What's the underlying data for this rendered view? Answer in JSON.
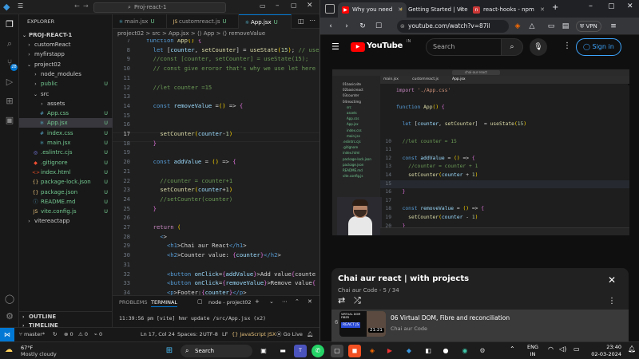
{
  "vscode": {
    "search_text": "Proj-react-1",
    "sidebar": {
      "header": "EXPLORER",
      "root": "PROJ-REACT-1",
      "items": [
        {
          "label": "customReact",
          "indent": 1,
          "kind": "folder",
          "badge": ""
        },
        {
          "label": "myfirstapp",
          "indent": 1,
          "kind": "folder",
          "badge": ""
        },
        {
          "label": "project02",
          "indent": 1,
          "kind": "folder-open",
          "badge": ""
        },
        {
          "label": "node_modules",
          "indent": 2,
          "kind": "folder",
          "badge": ""
        },
        {
          "label": "public",
          "indent": 2,
          "kind": "folder",
          "badge": "U"
        },
        {
          "label": "src",
          "indent": 2,
          "kind": "folder-open",
          "badge": ""
        },
        {
          "label": "assets",
          "indent": 3,
          "kind": "folder",
          "badge": ""
        },
        {
          "label": "App.css",
          "indent": 3,
          "kind": "css",
          "badge": "U"
        },
        {
          "label": "App.jsx",
          "indent": 3,
          "kind": "jsx",
          "badge": "U"
        },
        {
          "label": "index.css",
          "indent": 3,
          "kind": "css",
          "badge": "U"
        },
        {
          "label": "main.jsx",
          "indent": 3,
          "kind": "jsx",
          "badge": "U"
        },
        {
          "label": ".eslintrc.cjs",
          "indent": 2,
          "kind": "eslint",
          "badge": "U"
        },
        {
          "label": ".gitignore",
          "indent": 2,
          "kind": "git",
          "badge": "U"
        },
        {
          "label": "index.html",
          "indent": 2,
          "kind": "html",
          "badge": "U"
        },
        {
          "label": "package-lock.json",
          "indent": 2,
          "kind": "json",
          "badge": "U"
        },
        {
          "label": "package.json",
          "indent": 2,
          "kind": "json",
          "badge": "U"
        },
        {
          "label": "README.md",
          "indent": 2,
          "kind": "md",
          "badge": "U"
        },
        {
          "label": "vite.config.js",
          "indent": 2,
          "kind": "js",
          "badge": "U"
        },
        {
          "label": "vitereactapp",
          "indent": 1,
          "kind": "folder",
          "badge": ""
        }
      ],
      "outline": "OUTLINE",
      "timeline": "TIMELINE"
    },
    "tabs": [
      {
        "label": "main.jsx",
        "badge": "U"
      },
      {
        "label": "customreact.js",
        "badge": "U"
      },
      {
        "label": "App.jsx",
        "badge": "U"
      }
    ],
    "breadcrumb": "project02 > src > App.jsx > ⟨⟩ App > ⟨⟩ removeValue",
    "code": [
      {
        "n": "7",
        "t": "function App() {"
      },
      {
        "n": "8",
        "t": "  let [counter, setCounter] = useState(15); // use"
      },
      {
        "n": "9",
        "t": "  //const [counter, setCounter] = useState(15);"
      },
      {
        "n": "10",
        "t": "  // const give eroror that's why we use let here"
      },
      {
        "n": "11",
        "t": ""
      },
      {
        "n": "12",
        "t": "  //let counter =15"
      },
      {
        "n": "13",
        "t": ""
      },
      {
        "n": "14",
        "t": "  const removeValue =() => {"
      },
      {
        "n": "15",
        "t": ""
      },
      {
        "n": "16",
        "t": ""
      },
      {
        "n": "17",
        "t": "    setCounter(counter-1)"
      },
      {
        "n": "18",
        "t": "  }"
      },
      {
        "n": "19",
        "t": ""
      },
      {
        "n": "20",
        "t": "  const addValue = () => {"
      },
      {
        "n": "21",
        "t": ""
      },
      {
        "n": "22",
        "t": "    //counter = counter+1"
      },
      {
        "n": "23",
        "t": "    setCounter(counter+1)"
      },
      {
        "n": "24",
        "t": "    //setCounter(counter)"
      },
      {
        "n": "25",
        "t": "  }"
      },
      {
        "n": "26",
        "t": ""
      },
      {
        "n": "27",
        "t": "  return ("
      },
      {
        "n": "28",
        "t": "    <>"
      },
      {
        "n": "29",
        "t": "      <h1>Chai aur React</h1>"
      },
      {
        "n": "30",
        "t": "      <h2>Counter value: {counter}</h2>"
      },
      {
        "n": "31",
        "t": ""
      },
      {
        "n": "32",
        "t": "      <button onClick={addValue}>Add value{counte"
      },
      {
        "n": "33",
        "t": "      <button onClick={removeValue}>Remove value{"
      },
      {
        "n": "34",
        "t": "      <p>Footer:{counter}</p>"
      },
      {
        "n": "35",
        "t": "    </>"
      },
      {
        "n": "36",
        "t": "  )"
      },
      {
        "n": "37",
        "t": "}"
      },
      {
        "n": "38",
        "t": ""
      },
      {
        "n": "39",
        "t": "export default App"
      }
    ],
    "panel_tabs": [
      "PROBLEMS",
      "TERMINAL"
    ],
    "terminal_name": "node - project02",
    "terminal_text": "11:39:56 pm [vite] hmr update /src/App.jsx (x2)",
    "status": {
      "branch": "master*",
      "errors": "0",
      "warnings": "0",
      "ports": "0",
      "position": "Ln 17, Col 24",
      "spaces": "Spaces: 2",
      "encoding": "UTF-8",
      "eol": "LF",
      "language": "{} JavaScript JSX",
      "golive": "Go Live"
    }
  },
  "browser": {
    "tabs": [
      {
        "label": "Why you need",
        "fav": "▶",
        "color": "#ff0000"
      },
      {
        "label": "Getting Started | Vite",
        "fav": "⚡",
        "color": "#646cff"
      },
      {
        "label": "react-hooks - npm",
        "fav": "n",
        "color": "#cb3837"
      }
    ],
    "url": "youtube.com/watch?v=87il",
    "vpn": "VPN",
    "yt": {
      "logo": "YouTube",
      "region": "IN",
      "search_placeholder": "Search",
      "signin": "Sign in"
    },
    "video": {
      "inner_tabs": [
        "main.jsx",
        "customreact.js",
        "App.jsx"
      ],
      "inner_title": "chai-aur-react",
      "inner_files": [
        "01basicvite",
        "02basicreact",
        "03counter",
        "04reactimg",
        "src",
        "assets",
        "App.css",
        "App.jsx",
        "index.css",
        "main.jsx",
        ".eslintrc.cjs",
        ".gitignore",
        "index.html",
        "package-lock.json",
        "package.json",
        "README.md",
        "vite.config.js"
      ],
      "code": [
        {
          "n": "",
          "t": "import './App.css'"
        },
        {
          "n": "",
          "t": ""
        },
        {
          "n": "",
          "t": "function App() {"
        },
        {
          "n": "",
          "t": ""
        },
        {
          "n": "",
          "t": "  let [counter, setCounter]  = useState(15)"
        },
        {
          "n": "",
          "t": ""
        },
        {
          "n": "10",
          "t": "  //let counter = 15"
        },
        {
          "n": "11",
          "t": ""
        },
        {
          "n": "12",
          "t": "  const addValue = () => {"
        },
        {
          "n": "13",
          "t": "    //counter = counter + 1"
        },
        {
          "n": "14",
          "t": "    setCounter(counter + 1)"
        },
        {
          "n": "15",
          "t": ""
        },
        {
          "n": "16",
          "t": "  }"
        },
        {
          "n": "17",
          "t": ""
        },
        {
          "n": "18",
          "t": "  const removeValue = () => {"
        },
        {
          "n": "19",
          "t": "    setCounter(counter - 1)"
        },
        {
          "n": "20",
          "t": "  }"
        }
      ]
    },
    "playlist": {
      "title": "Chai aur react | with projects",
      "subtitle": "Chai aur Code - 5 / 34",
      "item_index": "6",
      "item_title": "06 Virtual DOM, Fibre and reconciliation",
      "item_channel": "Chai aur Code",
      "item_duration": "21:21",
      "thumb_label": "REACT JS"
    }
  },
  "taskbar": {
    "weather_temp": "67°F",
    "weather_desc": "Mostly cloudy",
    "search": "Search",
    "lang1": "ENG",
    "lang2": "IN",
    "time": "23:40",
    "date": "02-03-2024"
  },
  "colors": {
    "accent": "#0078d4",
    "yt_red": "#ff0000",
    "untracked": "#73c991"
  }
}
